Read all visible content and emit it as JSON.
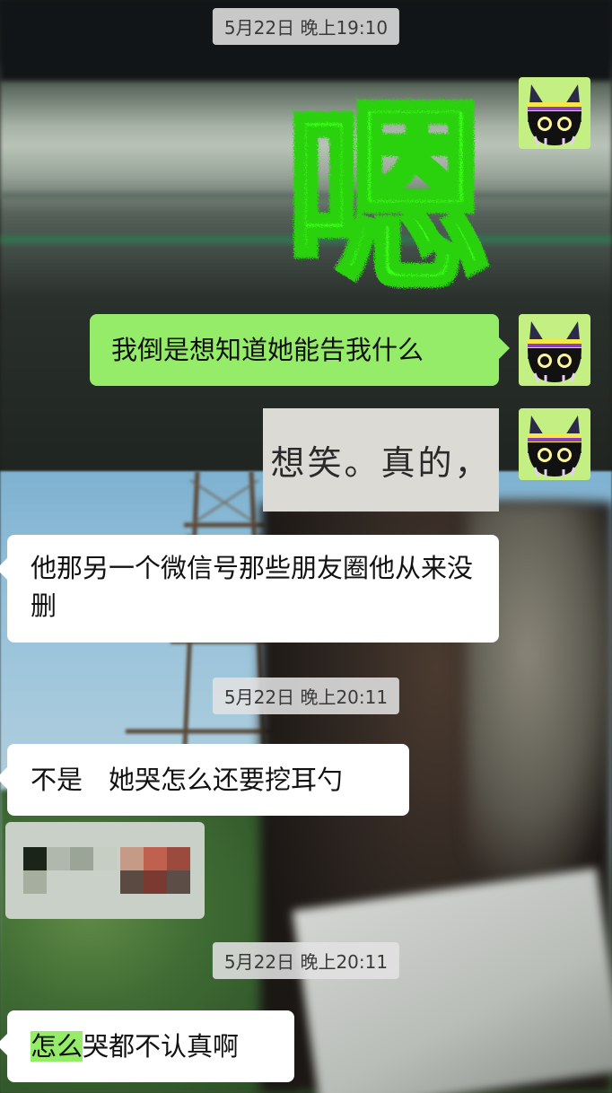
{
  "timestamps": [
    "5月22日 晚上19:10",
    "5月22日 晚上20:11",
    "5月22日 晚上20:11"
  ],
  "messages": {
    "sticker_text": "嗯",
    "out_text_1": "我倒是想知道她能告我什么",
    "image_caption": "想笑。真的，",
    "in_text_1": "他那另一个微信号那些朋友圈他从来没删",
    "in_text_2": "不是　她哭怎么还要挖耳勺",
    "in_text_3_highlight": "怎么",
    "in_text_3_rest": "哭都不认真啊"
  },
  "icons": {
    "avatar": "cat-avatar-icon",
    "sticker": "grass-text-sticker",
    "blurred": "blurred-image"
  },
  "colors": {
    "outgoing_bubble": "#95ec69",
    "incoming_bubble": "#ffffff",
    "sticker_green": "#39ff14",
    "avatar_bg": "#c4ef83"
  }
}
